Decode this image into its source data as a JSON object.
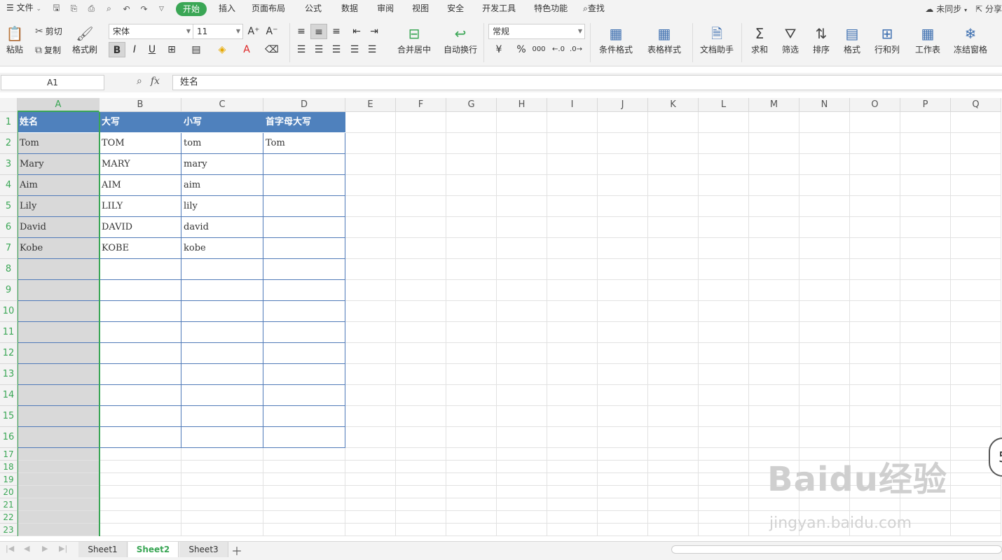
{
  "menubar": {
    "file_label": "文件",
    "tabs": [
      "开始",
      "插入",
      "页面布局",
      "公式",
      "数据",
      "审阅",
      "视图",
      "安全",
      "开发工具",
      "特色功能"
    ],
    "search_label": "查找",
    "sync_label": "未同步",
    "share_label": "分享"
  },
  "ribbon": {
    "paste": "粘贴",
    "cut": "剪切",
    "copy": "复制",
    "format_painter": "格式刷",
    "font_name": "宋体",
    "font_size": "11",
    "bold": "B",
    "italic": "I",
    "underline": "U",
    "merge_center": "合并居中",
    "wrap_text": "自动换行",
    "number_format": "常规",
    "percent": "%",
    "thousands": "000",
    "conditional_format": "条件格式",
    "table_style": "表格样式",
    "doc_assistant": "文档助手",
    "sum": "求和",
    "filter": "筛选",
    "sort": "排序",
    "format": "格式",
    "rows_cols": "行和列",
    "worksheet": "工作表",
    "freeze": "冻结窗格"
  },
  "formula_bar": {
    "name_box": "A1",
    "fx": "fx",
    "content": "姓名"
  },
  "columns": [
    "A",
    "B",
    "C",
    "D",
    "E",
    "F",
    "G",
    "H",
    "I",
    "J",
    "K",
    "L",
    "M",
    "N",
    "O",
    "P",
    "Q"
  ],
  "rows": [
    "1",
    "2",
    "3",
    "4",
    "5",
    "6",
    "7",
    "8",
    "9",
    "10",
    "11",
    "12",
    "13",
    "14",
    "15",
    "16",
    "17",
    "18",
    "19",
    "20",
    "21",
    "22",
    "23"
  ],
  "table": {
    "headers": [
      "姓名",
      "大写",
      "小写",
      "首字母大写"
    ],
    "data": [
      [
        "Tom",
        "TOM",
        "tom",
        "Tom"
      ],
      [
        "Mary",
        "MARY",
        "mary",
        ""
      ],
      [
        "Aim",
        "AIM",
        "aim",
        ""
      ],
      [
        "Lily",
        "LILY",
        "lily",
        ""
      ],
      [
        "David",
        "DAVID",
        "david",
        ""
      ],
      [
        "Kobe",
        "KOBE",
        "kobe",
        ""
      ]
    ]
  },
  "sheets": [
    "Sheet1",
    "Sheet2",
    "Sheet3"
  ],
  "active_sheet": "Sheet2",
  "watermark": {
    "main": "Baidu经验",
    "sub": "jingyan.baidu.com"
  },
  "float_badge": "5",
  "colors": {
    "accent": "#3aa655",
    "header_fill": "#4f81bd",
    "selected_col": "#d9d9d9"
  }
}
